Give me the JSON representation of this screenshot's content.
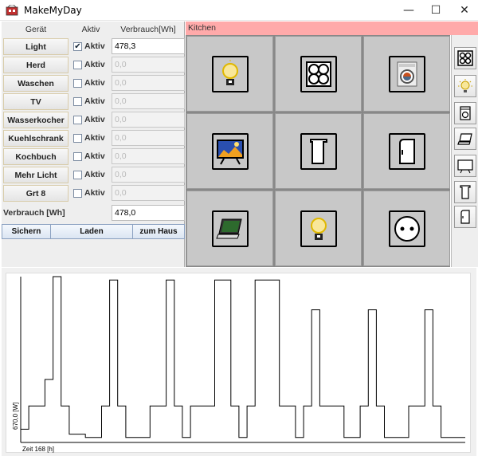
{
  "window": {
    "title": "MakeMyDay",
    "minimize": "—",
    "maximize": "☐",
    "close": "✕"
  },
  "table": {
    "headers": {
      "device": "Gerät",
      "active": "Aktiv",
      "consumption": "Verbrauch[Wh]"
    },
    "rows": [
      {
        "device": "Light",
        "active_label": "Aktiv",
        "checked": true,
        "value": "478,3"
      },
      {
        "device": "Herd",
        "active_label": "Aktiv",
        "checked": false,
        "value": "0,0"
      },
      {
        "device": "Waschen",
        "active_label": "Aktiv",
        "checked": false,
        "value": "0,0"
      },
      {
        "device": "TV",
        "active_label": "Aktiv",
        "checked": false,
        "value": "0,0"
      },
      {
        "device": "Wasserkocher",
        "active_label": "Aktiv",
        "checked": false,
        "value": "0,0"
      },
      {
        "device": "Kuehlschrank",
        "active_label": "Aktiv",
        "checked": false,
        "value": "0,0"
      },
      {
        "device": "Kochbuch",
        "active_label": "Aktiv",
        "checked": false,
        "value": "0,0"
      },
      {
        "device": "Mehr Licht",
        "active_label": "Aktiv",
        "checked": false,
        "value": "0,0"
      },
      {
        "device": "Grt 8",
        "active_label": "Aktiv",
        "checked": false,
        "value": "0,0"
      }
    ],
    "total_label": "Verbrauch [Wh]",
    "total_value": "478,0"
  },
  "actions": {
    "save": "Sichern",
    "load": "Laden",
    "home": "zum Haus"
  },
  "room": {
    "name": "Kitchen",
    "color": "#ffaaaa"
  },
  "tiles": [
    {
      "name": "lightbulb-icon"
    },
    {
      "name": "stove-icon"
    },
    {
      "name": "washing-machine-icon"
    },
    {
      "name": "tv-icon"
    },
    {
      "name": "kettle-icon"
    },
    {
      "name": "fridge-icon"
    },
    {
      "name": "laptop-icon"
    },
    {
      "name": "lightbulb-icon"
    },
    {
      "name": "power-outlet-icon"
    }
  ],
  "sidebar_icons": [
    "stove-icon",
    "lightbulb-icon",
    "washing-machine-icon",
    "laptop-icon",
    "tv-icon",
    "kettle-icon",
    "fridge-icon"
  ],
  "chart_data": {
    "type": "line",
    "ylabel": "670,0 [W]",
    "xlabel": "Zeit   168 [h]",
    "note": "Step line of power over time; levels estimated as fraction of full scale (0..1).",
    "x": [
      0,
      1,
      1,
      3,
      3,
      4,
      4,
      5,
      5,
      6,
      6,
      8,
      8,
      10,
      10,
      11,
      11,
      12,
      12,
      13,
      13,
      16,
      16,
      18,
      18,
      19,
      19,
      20,
      20,
      21,
      21,
      24,
      24,
      26,
      26,
      27,
      27,
      28,
      28,
      29,
      29,
      32,
      32,
      34,
      34,
      35,
      35,
      36,
      36,
      37,
      37,
      40,
      40,
      42,
      42,
      43,
      43,
      44,
      44,
      45,
      45,
      48,
      48,
      50,
      50,
      51,
      51,
      52,
      52,
      55,
      55
    ],
    "y": [
      0.08,
      0.08,
      0.22,
      0.22,
      0.38,
      0.38,
      1.0,
      1.0,
      0.22,
      0.22,
      0.05,
      0.05,
      0.03,
      0.03,
      0.22,
      0.22,
      0.98,
      0.98,
      0.22,
      0.22,
      0.03,
      0.03,
      0.22,
      0.22,
      0.98,
      0.98,
      0.22,
      0.22,
      0.03,
      0.03,
      0.22,
      0.22,
      0.98,
      0.98,
      0.22,
      0.22,
      0.03,
      0.03,
      0.22,
      0.22,
      0.98,
      0.98,
      0.22,
      0.22,
      0.03,
      0.03,
      0.22,
      0.22,
      0.8,
      0.8,
      0.22,
      0.22,
      0.03,
      0.03,
      0.22,
      0.22,
      0.8,
      0.8,
      0.22,
      0.22,
      0.03,
      0.03,
      0.22,
      0.22,
      0.8,
      0.8,
      0.22,
      0.22,
      0.03,
      0.03,
      0.03
    ],
    "xlim": [
      0,
      55
    ],
    "ylim": [
      0,
      1
    ],
    "grid": false
  }
}
